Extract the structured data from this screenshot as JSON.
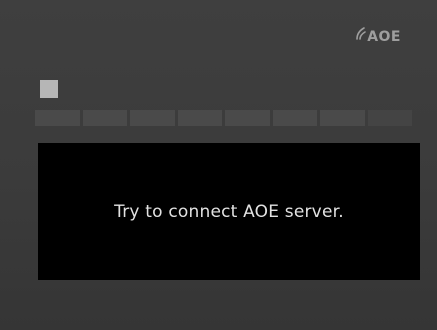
{
  "brand": {
    "text": "AOE",
    "icon": "signal-arc-icon",
    "color": "#9e9e9e"
  },
  "status": {
    "indicator_color": "#b6b6b6"
  },
  "signal_bar": {
    "segments_total": 8,
    "segments_filled": 0
  },
  "message": {
    "text": "Try to connect AOE server."
  },
  "colors": {
    "background": "#3d3d3d",
    "panel": "#000000",
    "message_text": "#e2e2e2"
  }
}
